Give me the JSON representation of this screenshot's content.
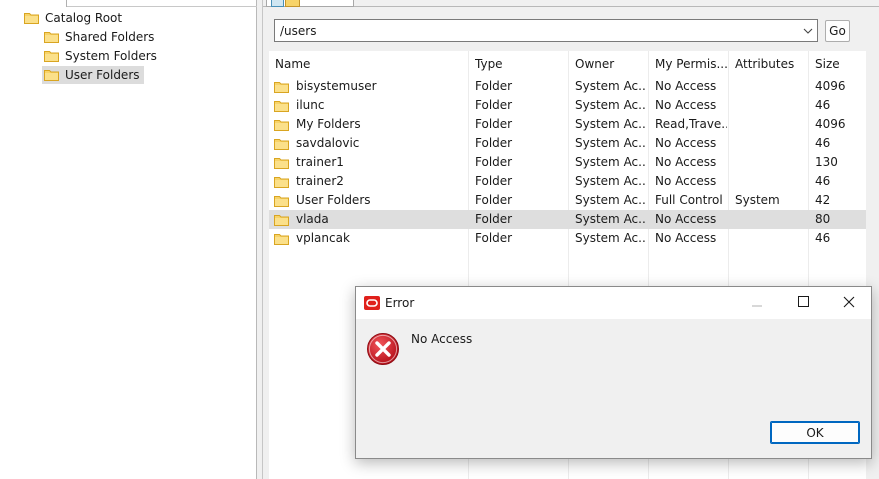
{
  "tree": {
    "items": [
      {
        "label": "Catalog Root",
        "icon": "folder-icon",
        "level": 0,
        "selected": false
      },
      {
        "label": "Shared Folders",
        "icon": "folder-icon",
        "level": 1,
        "selected": false
      },
      {
        "label": "System Folders",
        "icon": "folder-icon",
        "level": 1,
        "selected": false
      },
      {
        "label": "User Folders",
        "icon": "folder-icon",
        "level": 1,
        "selected": true
      }
    ]
  },
  "path_bar": {
    "value": "/users",
    "go_label": "Go"
  },
  "file_list": {
    "columns": [
      "Name",
      "Type",
      "Owner",
      "My Permis...",
      "Attributes",
      "Size"
    ],
    "rows": [
      {
        "name": "bisystemuser",
        "type": "Folder",
        "owner": "System Ac...",
        "permissions": "No Access",
        "attributes": "",
        "size": "4096"
      },
      {
        "name": "ilunc",
        "type": "Folder",
        "owner": "System Ac...",
        "permissions": "No Access",
        "attributes": "",
        "size": "46"
      },
      {
        "name": "My Folders",
        "type": "Folder",
        "owner": "System Ac...",
        "permissions": "Read,Trave...",
        "attributes": "",
        "size": "4096"
      },
      {
        "name": "savdalovic",
        "type": "Folder",
        "owner": "System Ac...",
        "permissions": "No Access",
        "attributes": "",
        "size": "46"
      },
      {
        "name": "trainer1",
        "type": "Folder",
        "owner": "System Ac...",
        "permissions": "No Access",
        "attributes": "",
        "size": "130"
      },
      {
        "name": "trainer2",
        "type": "Folder",
        "owner": "System Ac...",
        "permissions": "No Access",
        "attributes": "",
        "size": "46"
      },
      {
        "name": "User Folders",
        "type": "Folder",
        "owner": "System Ac...",
        "permissions": "Full Control",
        "attributes": "System",
        "size": "42"
      },
      {
        "name": "vlada",
        "type": "Folder",
        "owner": "System Ac...",
        "permissions": "No Access",
        "attributes": "",
        "size": "80",
        "highlighted": true
      },
      {
        "name": "vplancak",
        "type": "Folder",
        "owner": "System Ac...",
        "permissions": "No Access",
        "attributes": "",
        "size": "46"
      }
    ]
  },
  "dialog": {
    "title": "Error",
    "message": "No Access",
    "ok_label": "OK",
    "app_icon": "oracle-icon",
    "message_icon": "error-icon"
  },
  "colors": {
    "folder_fill": "#f7d368",
    "folder_edge": "#d9a521",
    "error_red": "#d0181c",
    "oracle_red": "#e0201b",
    "selection_gray": "#dedede",
    "ok_border": "#0067c0"
  }
}
